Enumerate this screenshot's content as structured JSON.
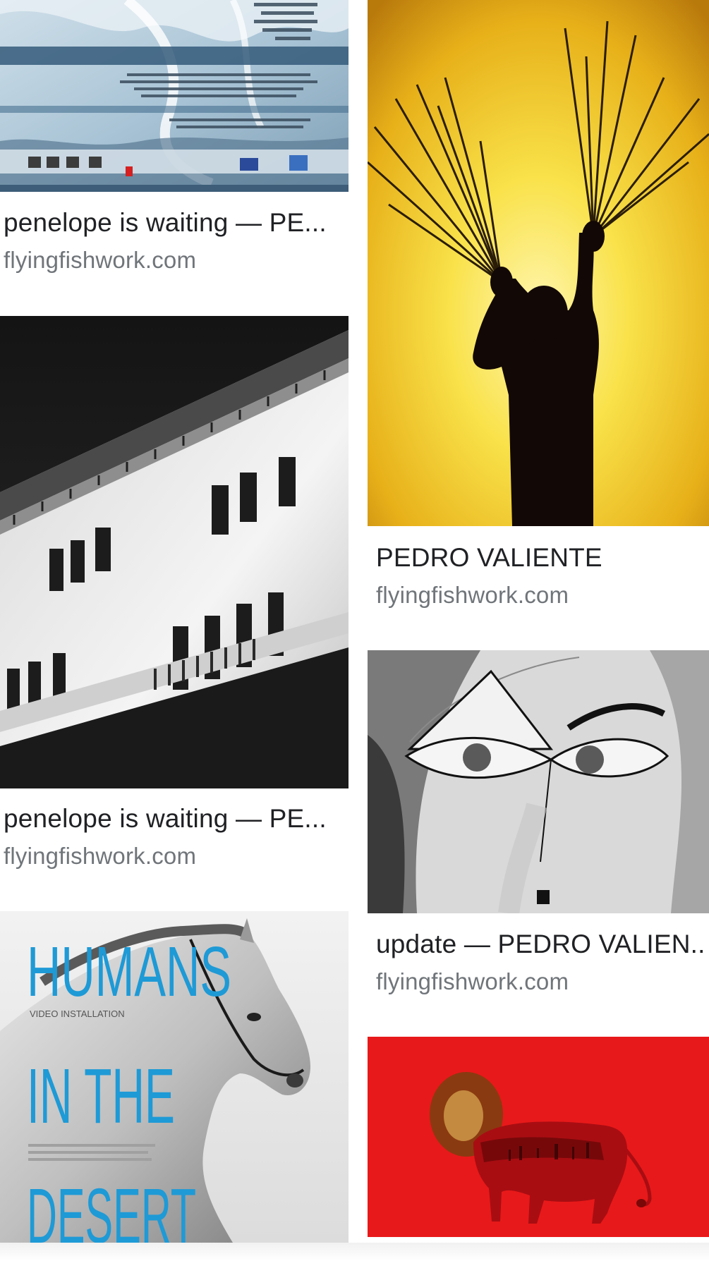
{
  "results": [
    {
      "title": "penelope is waiting — PE...",
      "source": "flyingfishwork.com"
    },
    {
      "title": "PEDRO VALIENTE",
      "source": "flyingfishwork.com"
    },
    {
      "title": "penelope is waiting — PE...",
      "source": "flyingfishwork.com"
    },
    {
      "title": "update — PEDRO VALIEN...",
      "source": "flyingfishwork.com"
    },
    {
      "title": "",
      "source": "",
      "poster_text": [
        "HUMANS",
        "VIDEO INSTALLATION",
        "IN THE",
        "DESERT"
      ]
    },
    {
      "title": "",
      "source": ""
    }
  ],
  "colors": {
    "title": "#202124",
    "source": "#70757a",
    "poster_blue": "#1e9ad6",
    "lion_red": "#e8191a"
  }
}
